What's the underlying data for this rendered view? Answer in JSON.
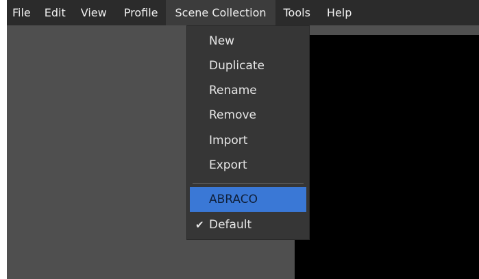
{
  "menubar": {
    "items": [
      {
        "label": "File"
      },
      {
        "label": "Edit"
      },
      {
        "label": "View"
      },
      {
        "label": "Profile"
      },
      {
        "label": "Scene Collection"
      },
      {
        "label": "Tools"
      },
      {
        "label": "Help"
      }
    ]
  },
  "scene_collection_menu": {
    "actions": [
      {
        "label": "New"
      },
      {
        "label": "Duplicate"
      },
      {
        "label": "Rename"
      },
      {
        "label": "Remove"
      },
      {
        "label": "Import"
      },
      {
        "label": "Export"
      }
    ],
    "collections": [
      {
        "label": "ABRACO",
        "highlighted": true
      },
      {
        "label": "Default",
        "checked": true
      }
    ],
    "check_icon": "checkmark-icon"
  },
  "colors": {
    "menubar_bg": "#2b2b2b",
    "dropdown_bg": "#363636",
    "highlight": "#3a78d6",
    "panel_bg": "#4f4f4f",
    "preview_bg": "#000000"
  }
}
